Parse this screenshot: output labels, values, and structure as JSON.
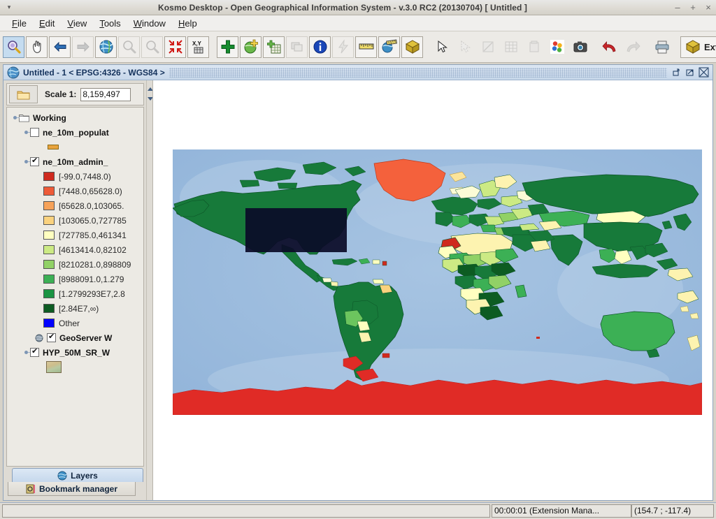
{
  "window": {
    "title": "Kosmo Desktop - Open Geographical Information System - v.3.0 RC2 (20130704)  [ Untitled ]",
    "menu_dot": "▾",
    "minimize": "–",
    "maximize": "+",
    "close": "×"
  },
  "menubar": [
    {
      "label": "File",
      "mnemonic": "F"
    },
    {
      "label": "Edit",
      "mnemonic": "E"
    },
    {
      "label": "View",
      "mnemonic": "V"
    },
    {
      "label": "Tools",
      "mnemonic": "T"
    },
    {
      "label": "Window",
      "mnemonic": "W"
    },
    {
      "label": "Help",
      "mnemonic": "H"
    }
  ],
  "toolbar": {
    "groups": [
      {
        "buttons": [
          {
            "name": "zoom-in-tool",
            "icon": "magnifier-plus-icon",
            "selected": true,
            "disabled": false
          },
          {
            "name": "pan-tool",
            "icon": "hand-pan-icon",
            "selected": false,
            "disabled": false
          },
          {
            "name": "previous-extent",
            "icon": "arrow-left-icon",
            "selected": false,
            "disabled": false
          },
          {
            "name": "next-extent",
            "icon": "arrow-right-icon",
            "selected": false,
            "disabled": true
          },
          {
            "name": "zoom-full-extent",
            "icon": "globe-icon",
            "selected": false,
            "disabled": false
          },
          {
            "name": "zoom-to-selected",
            "icon": "magnifier-small-icon",
            "selected": false,
            "disabled": true
          },
          {
            "name": "zoom-to-layer",
            "icon": "magnifier-minus-icon",
            "selected": false,
            "disabled": true
          },
          {
            "name": "zoom-to-extent",
            "icon": "arrows-inward-icon",
            "selected": false,
            "disabled": false
          },
          {
            "name": "go-to-coordinate",
            "icon": "xy-coordinate-icon",
            "selected": false,
            "disabled": false
          }
        ]
      },
      {
        "buttons": [
          {
            "name": "add-layer",
            "icon": "plus-green-icon",
            "selected": false,
            "disabled": false
          },
          {
            "name": "add-wms-layer",
            "icon": "globe-plus-icon",
            "selected": false,
            "disabled": false
          },
          {
            "name": "add-table-layer",
            "icon": "table-plus-icon",
            "selected": false,
            "disabled": false
          },
          {
            "name": "layer-properties",
            "icon": "layers-stack-icon",
            "selected": false,
            "disabled": true
          },
          {
            "name": "feature-info",
            "icon": "info-circle-icon",
            "selected": false,
            "disabled": false
          },
          {
            "name": "quick-style",
            "icon": "lightning-icon",
            "selected": false,
            "disabled": true
          },
          {
            "name": "measure-distance",
            "icon": "ruler-icon",
            "selected": false,
            "disabled": false
          },
          {
            "name": "measure-area",
            "icon": "globe-ruler-icon",
            "selected": false,
            "disabled": false
          },
          {
            "name": "three-d-view",
            "icon": "cube-box-icon",
            "selected": false,
            "disabled": false
          }
        ]
      },
      {
        "buttons": [
          {
            "name": "select-pointer",
            "icon": "cursor-arrow-icon",
            "selected": false,
            "disabled": false
          },
          {
            "name": "select-feature",
            "icon": "cursor-select-icon",
            "selected": false,
            "disabled": true
          },
          {
            "name": "edit-geometry",
            "icon": "pencil-edit-icon",
            "selected": false,
            "disabled": true
          },
          {
            "name": "attribute-table",
            "icon": "grid-table-icon",
            "selected": false,
            "disabled": true
          },
          {
            "name": "delete-feature",
            "icon": "trash-can-icon",
            "selected": false,
            "disabled": true
          },
          {
            "name": "symbology",
            "icon": "color-dots-icon",
            "selected": false,
            "disabled": false
          },
          {
            "name": "screenshot",
            "icon": "camera-icon",
            "selected": false,
            "disabled": false
          }
        ]
      },
      {
        "buttons": [
          {
            "name": "undo",
            "icon": "undo-arrow-icon",
            "selected": false,
            "disabled": false
          },
          {
            "name": "redo",
            "icon": "redo-arrow-icon",
            "selected": false,
            "disabled": true
          }
        ]
      },
      {
        "buttons": [
          {
            "name": "print",
            "icon": "printer-icon",
            "selected": false,
            "disabled": false
          }
        ]
      },
      {
        "buttons": [
          {
            "name": "extensions-manager",
            "icon": "package-box-icon",
            "selected": false,
            "disabled": false,
            "label": "Ext"
          }
        ]
      }
    ]
  },
  "mdi": {
    "title": "Untitled - 1 < EPSG:4326 - WGS84 >",
    "icon": "globe-icon",
    "restore_down": "restore-down-icon",
    "maximize": "maximize-icon",
    "close": "close-icon"
  },
  "scale": {
    "folder_icon": "folder-icon",
    "label": "Scale 1:",
    "value": "8,159,497"
  },
  "tree": {
    "root": {
      "label": "Working",
      "icon": "folder-icon"
    },
    "layers": [
      {
        "name": "ne_10m_populated_places",
        "label": "ne_10m_populat",
        "checked": false,
        "symbol_color": "#e8a33d",
        "symbol_kind": "point"
      },
      {
        "name": "ne_10m_admin_0_countries",
        "label": "ne_10m_admin_",
        "checked": true,
        "classes": [
          {
            "color": "#cf2a1e",
            "label": "[-99.0,7448.0)"
          },
          {
            "color": "#ee5b38",
            "label": "[7448.0,65628.0)"
          },
          {
            "color": "#f6a259",
            "label": "[65628.0,103065."
          },
          {
            "color": "#fad27e",
            "label": "[103065.0,727785"
          },
          {
            "color": "#ffffc0",
            "label": "[727785.0,461341"
          },
          {
            "color": "#ccea84",
            "label": "[4613414.0,82102"
          },
          {
            "color": "#91d166",
            "label": "[8210281.0,898809"
          },
          {
            "color": "#3cb055",
            "label": "[8988091.0,1.279"
          },
          {
            "color": "#1a9442",
            "label": "[1.2799293E7,2.8"
          },
          {
            "color": "#0d5c22",
            "label": "[2.84E7,∞)"
          },
          {
            "color": "#0000ff",
            "label": "Other"
          }
        ]
      },
      {
        "name": "geoserver-wms",
        "label": "GeoServer W",
        "checked": true,
        "icon": "globe-small-icon"
      },
      {
        "name": "HYP_50M_SR_W",
        "label": "HYP_50M_SR_W",
        "checked": true,
        "raster_preview": true
      }
    ]
  },
  "dock_tabs": [
    {
      "name": "tab-layers",
      "label": "Layers",
      "icon": "globe-icon",
      "active": true
    },
    {
      "name": "tab-bookmark",
      "label": "Bookmark manager",
      "icon": "bookmark-icon",
      "active": false
    }
  ],
  "statusbar": {
    "message": "",
    "extension": "00:00:01 (Extension Mana...",
    "coordinates": "(154.7 ; -117.4)"
  },
  "map": {
    "ocean_color": "#9dbcdd",
    "selection_box_color": "#0b0b28",
    "antarctica_color": "#e02b26",
    "greenland_color": "#f4613c",
    "default_land_color": "#1a7a3c"
  }
}
